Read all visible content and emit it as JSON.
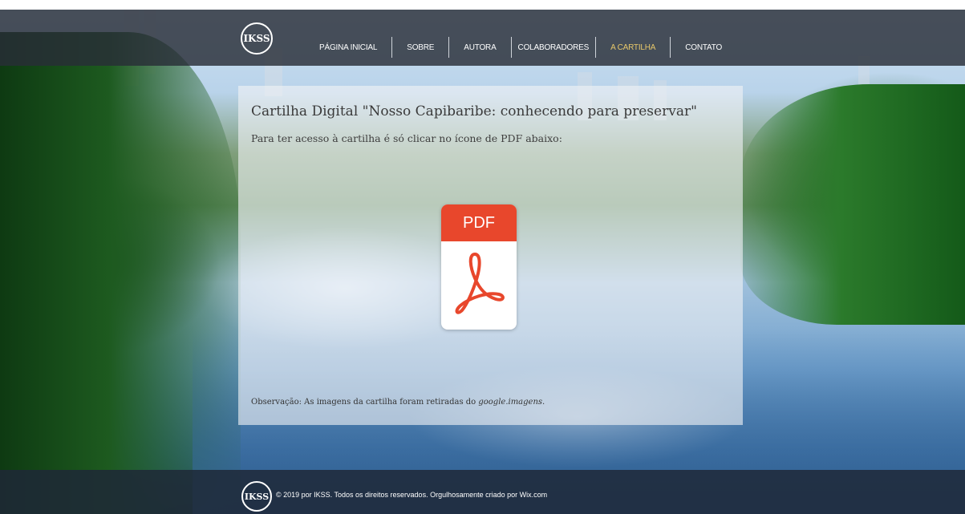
{
  "header": {
    "logo_text": "IKSS",
    "nav": [
      {
        "label": "PÁGINA INICIAL",
        "active": false
      },
      {
        "label": "SOBRE",
        "active": false
      },
      {
        "label": "AUTORA",
        "active": false
      },
      {
        "label": "COLABORADORES",
        "active": false
      },
      {
        "label": "A CARTILHA",
        "active": true
      },
      {
        "label": "CONTATO",
        "active": false
      }
    ],
    "active_color": "#e7c76a"
  },
  "main": {
    "title": "Cartilha Digital \"Nosso Capibaribe: conhecendo para preservar\"",
    "subtitle": "Para ter acesso à cartilha é só clicar no ícone de PDF abaixo:",
    "pdf_icon": {
      "label": "PDF",
      "icon": "pdf-icon",
      "color": "#e8472c"
    },
    "note_prefix": "Observação: As imagens da cartilha foram retiradas do ",
    "note_source": "google.imagens",
    "note_suffix": "."
  },
  "footer": {
    "logo_text": "IKSS",
    "text": "© 2019 por IKSS. Todos os direitos reservados. Orgulhosamente criado por Wix.com"
  }
}
